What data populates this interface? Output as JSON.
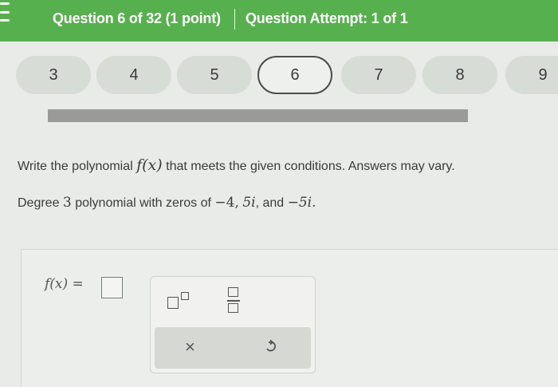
{
  "header": {
    "question_label": "Question 6 of 32 (1 point)",
    "attempt_label": "Question Attempt: 1 of 1",
    "accent_color": "#57b04e"
  },
  "nav": {
    "pills": [
      "3",
      "4",
      "5",
      "6",
      "7",
      "8",
      "9"
    ],
    "current": "6"
  },
  "question": {
    "prompt_before": "Write the polynomial ",
    "prompt_math": "f(x)",
    "prompt_after": " that meets the given conditions. Answers may vary.",
    "conditions_before": "Degree ",
    "degree": "3",
    "conditions_middle": " polynomial with zeros of ",
    "zero1": "−4,",
    "zero2": "5i",
    "sep": ",  and ",
    "zero3": "−5i."
  },
  "answer": {
    "lhs_label": "f(x) ="
  },
  "toolbar": {
    "exponent_icon": "exponent-icon",
    "fraction_icon": "fraction-icon",
    "clear_label": "×",
    "undo_icon": "undo-icon"
  }
}
